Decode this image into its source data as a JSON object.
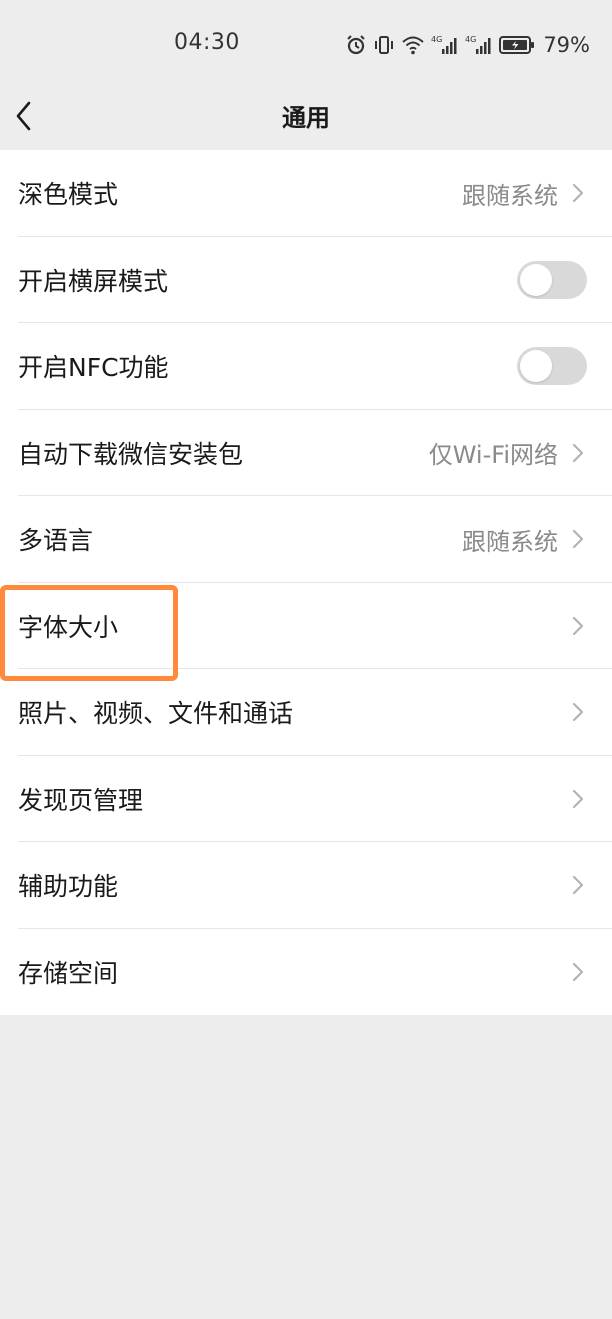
{
  "status_bar": {
    "time": "04:30",
    "battery_percent": "79%",
    "icons": [
      "alarm-icon",
      "vibrate-icon",
      "wifi-icon",
      "signal-4g-icon",
      "signal-4g-icon",
      "battery-charging-icon"
    ]
  },
  "nav": {
    "title": "通用",
    "back_icon": "chevron-left-icon"
  },
  "settings": [
    {
      "label": "深色模式",
      "value": "跟随系统",
      "type": "link"
    },
    {
      "label": "开启横屏模式",
      "type": "toggle",
      "on": false
    },
    {
      "label": "开启NFC功能",
      "type": "toggle",
      "on": false
    },
    {
      "label": "自动下载微信安装包",
      "value": "仅Wi-Fi网络",
      "type": "link"
    },
    {
      "label": "多语言",
      "value": "跟随系统",
      "type": "link"
    },
    {
      "label": "字体大小",
      "value": "",
      "type": "link",
      "highlighted": true
    },
    {
      "label": "照片、视频、文件和通话",
      "value": "",
      "type": "link"
    },
    {
      "label": "发现页管理",
      "value": "",
      "type": "link"
    },
    {
      "label": "辅助功能",
      "value": "",
      "type": "link"
    },
    {
      "label": "存储空间",
      "value": "",
      "type": "link"
    }
  ],
  "colors": {
    "background": "#ededed",
    "list_background": "#ffffff",
    "highlight": "#ff8a3c",
    "toggle_off": "#d9d9d9",
    "secondary_text": "#8a8a8a"
  }
}
